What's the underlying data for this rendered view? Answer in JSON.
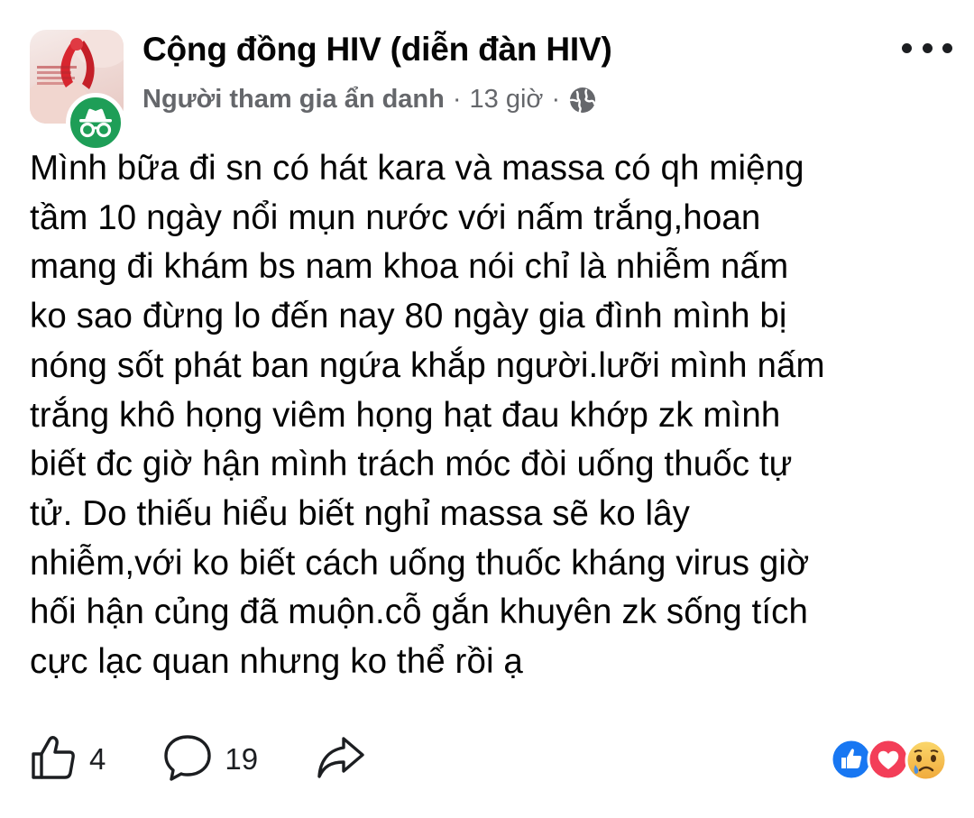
{
  "post": {
    "group_name": "Cộng đồng HIV (diễn đàn HIV)",
    "author": "Người tham gia ẩn danh",
    "separator": "·",
    "time": "13 giờ",
    "lines": [
      "Mình bữa đi sn có hát kara và massa có qh miệng",
      "tầm 10 ngày nổi mụn nước với nấm trắng,hoan",
      "mang đi khám bs nam khoa nói chỉ là nhiễm nấm",
      "ko sao đừng lo đến nay 80 ngày gia đình mình bị",
      "nóng sốt phát ban ngứa khắp người.lưỡi mình nấm",
      "trắng khô họng viêm họng hạt đau khớp zk mình",
      "biết đc giờ hận mình trách móc đòi uống thuốc tự",
      "tử. Do thiếu hiểu biết nghỉ massa sẽ ko lây",
      "nhiễm,với ko biết cách uống thuốc kháng virus giờ",
      "hối hận củng đã muộn.cỗ gắn khuyên zk sống tích",
      "cực lạc quan nhưng ko thể rồi ạ"
    ]
  },
  "actions": {
    "like_count": "4",
    "comment_count": "19"
  },
  "icons": {
    "avatar": "group-avatar",
    "badge": "anonymous-incognito-icon",
    "privacy": "globe-icon",
    "more": "more-options-icon",
    "like": "thumbs-up-icon",
    "comment": "comment-bubble-icon",
    "share": "share-arrow-icon",
    "reactions": [
      "like-reaction-icon",
      "love-reaction-icon",
      "sad-reaction-icon"
    ]
  },
  "colors": {
    "badge": "#1e9e57",
    "like_reaction": "#1877f2",
    "love_reaction": "#f33e58",
    "meta_text": "#65676b"
  }
}
